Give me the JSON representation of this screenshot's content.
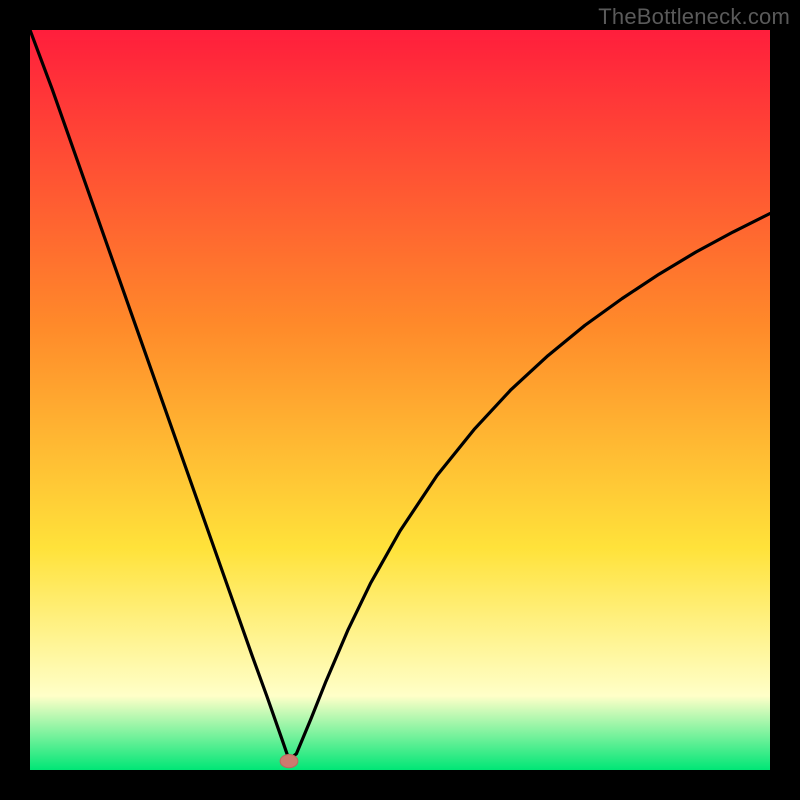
{
  "watermark": "TheBottleneck.com",
  "colors": {
    "frame_bg": "#000000",
    "gradient_top": "#ff1e3c",
    "gradient_mid1": "#ff8a2a",
    "gradient_mid2": "#ffe23a",
    "gradient_pale": "#ffffc8",
    "gradient_bottom": "#00e676",
    "curve": "#000000",
    "marker_fill": "#cc7b6f",
    "marker_stroke": "#b96a5f"
  },
  "chart_data": {
    "type": "line",
    "title": "",
    "xlabel": "",
    "ylabel": "",
    "xlim": [
      0,
      100
    ],
    "ylim": [
      0,
      100
    ],
    "grid": false,
    "legend": false,
    "annotations": [],
    "series": [
      {
        "name": "bottleneck-curve",
        "x": [
          0,
          3,
          6,
          9,
          12,
          15,
          18,
          21,
          24,
          27,
          30,
          32,
          34,
          35,
          36,
          38,
          40,
          43,
          46,
          50,
          55,
          60,
          65,
          70,
          75,
          80,
          85,
          90,
          95,
          100
        ],
        "values": [
          100,
          92,
          83.5,
          75,
          66.5,
          58,
          49.5,
          41,
          32.5,
          24,
          15.5,
          10,
          4.3,
          1.4,
          2.2,
          7,
          12,
          19,
          25.2,
          32.3,
          39.8,
          46,
          51.4,
          56,
          60.1,
          63.7,
          67,
          70,
          72.7,
          75.2
        ]
      }
    ],
    "marker": {
      "name": "optimal-point",
      "x": 35,
      "y": 1.2,
      "rx": 1.2,
      "ry": 0.9
    },
    "background_gradient_stops": [
      {
        "offset": 0.0,
        "color_key": "gradient_top"
      },
      {
        "offset": 0.4,
        "color_key": "gradient_mid1"
      },
      {
        "offset": 0.7,
        "color_key": "gradient_mid2"
      },
      {
        "offset": 0.9,
        "color_key": "gradient_pale"
      },
      {
        "offset": 1.0,
        "color_key": "gradient_bottom"
      }
    ]
  }
}
